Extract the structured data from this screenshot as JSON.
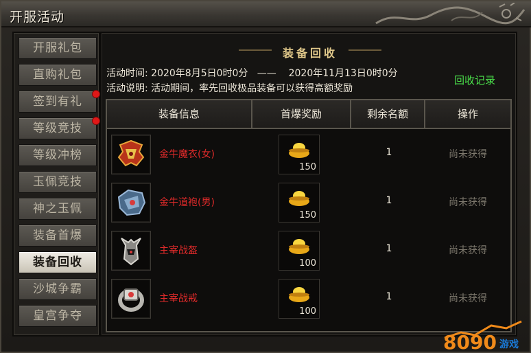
{
  "window": {
    "title": "开服活动"
  },
  "sidebar": {
    "items": [
      {
        "label": "开服礼包",
        "active": false,
        "dot": false
      },
      {
        "label": "直购礼包",
        "active": false,
        "dot": false
      },
      {
        "label": "签到有礼",
        "active": false,
        "dot": true
      },
      {
        "label": "等级竞技",
        "active": false,
        "dot": true
      },
      {
        "label": "等级冲榜",
        "active": false,
        "dot": false
      },
      {
        "label": "玉佩竞技",
        "active": false,
        "dot": false
      },
      {
        "label": "神之玉佩",
        "active": false,
        "dot": false
      },
      {
        "label": "装备首爆",
        "active": false,
        "dot": false
      },
      {
        "label": "装备回收",
        "active": true,
        "dot": false
      },
      {
        "label": "沙城争霸",
        "active": false,
        "dot": false
      },
      {
        "label": "皇宫争夺",
        "active": false,
        "dot": false
      }
    ]
  },
  "main": {
    "header": "装备回收",
    "time_label": "活动时间:",
    "time_start": "2020年8月5日0时0分",
    "time_sep": "——",
    "time_end": "2020年11月13日0时0分",
    "desc_label": "活动说明:",
    "desc": "活动期间，率先回收极品装备可以获得高额奖励",
    "record_link": "回收记录",
    "table": {
      "headers": [
        "装备信息",
        "首爆奖励",
        "剩余名额",
        "操作"
      ],
      "rows": [
        {
          "icon": "demon-armor-icon",
          "name": "金牛魔衣(女)",
          "reward_icon": "gold-ingot-icon",
          "reward": "150",
          "remain": "1",
          "status": "尚未获得"
        },
        {
          "icon": "taoist-robe-icon",
          "name": "金牛道袍(男)",
          "reward_icon": "gold-ingot-icon",
          "reward": "150",
          "remain": "1",
          "status": "尚未获得"
        },
        {
          "icon": "helmet-icon",
          "name": "主宰战盔",
          "reward_icon": "gold-ingot-icon",
          "reward": "100",
          "remain": "1",
          "status": "尚未获得"
        },
        {
          "icon": "ring-icon",
          "name": "主宰战戒",
          "reward_icon": "gold-ingot-icon",
          "reward": "100",
          "remain": "1",
          "status": "尚未获得"
        }
      ]
    }
  },
  "watermark": {
    "text": "8090",
    "suffix": "游戏"
  },
  "colors": {
    "item_name": "#e02a2a",
    "record_link": "#4ae04a",
    "status": "#7d786d",
    "header_gold": "#e0c88a"
  }
}
